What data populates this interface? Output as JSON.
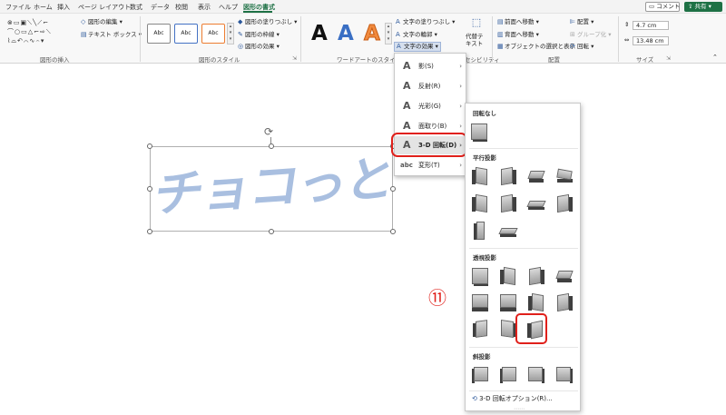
{
  "tabs": [
    {
      "label": "ファイル",
      "active": false
    },
    {
      "label": "ホーム",
      "active": false
    },
    {
      "label": "挿入",
      "active": false
    },
    {
      "label": "ページ レイアウト",
      "active": false
    },
    {
      "label": "数式",
      "active": false
    },
    {
      "label": "データ",
      "active": false
    },
    {
      "label": "校閲",
      "active": false
    },
    {
      "label": "表示",
      "active": false
    },
    {
      "label": "ヘルプ",
      "active": false
    },
    {
      "label": "図形の書式",
      "active": true
    }
  ],
  "topbar": {
    "comment_label": "コメント",
    "share_label": "共有"
  },
  "ribbon": {
    "insert_shapes": {
      "edit_shape": "図形の編集",
      "text_box": "テキスト ボックス",
      "label": "図形の挿入"
    },
    "shape_styles": {
      "gallery": [
        "Abc",
        "Abc",
        "Abc"
      ],
      "fill": "図形の塗りつぶし",
      "outline": "図形の枠線",
      "effects": "図形の効果",
      "label": "図形のスタイル"
    },
    "wordart_styles": {
      "letters": [
        "A",
        "A",
        "A"
      ],
      "text_fill": "文字の塗りつぶし",
      "text_outline": "文字の輪郭",
      "text_effects": "文字の効果",
      "label": "ワードアートのスタイ"
    },
    "accessibility": {
      "alt_text_line1": "代替テ",
      "alt_text_line2": "キスト",
      "label": "セシビリティ"
    },
    "arrange": {
      "bring_forward": "前面へ移動",
      "send_backward": "背面へ移動",
      "selection_pane": "オブジェクトの選択と表示",
      "align": "配置",
      "group": "グループ化",
      "rotate": "回転",
      "label": "配置"
    },
    "size": {
      "height": "4.7 cm",
      "width": "13.48 cm",
      "label": "サイズ"
    }
  },
  "canvas": {
    "wordart_text": "チョコっと",
    "step_marker": "⑪"
  },
  "effects_menu": {
    "items": [
      {
        "icon": "A",
        "label": "影(S)"
      },
      {
        "icon": "A",
        "label": "反射(R)"
      },
      {
        "icon": "A",
        "label": "光彩(G)"
      },
      {
        "icon": "A",
        "label": "面取り(B)"
      },
      {
        "icon": "A",
        "label": "3-D 回転(D)"
      },
      {
        "icon": "abc",
        "label": "変形(T)"
      }
    ],
    "arrow": "›"
  },
  "rotation_panel": {
    "no_rotation_label": "回転なし",
    "parallel_label": "平行投影",
    "perspective_label": "透視投影",
    "oblique_label": "斜投影",
    "options_label": "3-D 回転オプション(R)..."
  },
  "colors": {
    "accent": "#1e7145",
    "highlight": "#e0201b",
    "wordart": "#a9bfe0"
  }
}
